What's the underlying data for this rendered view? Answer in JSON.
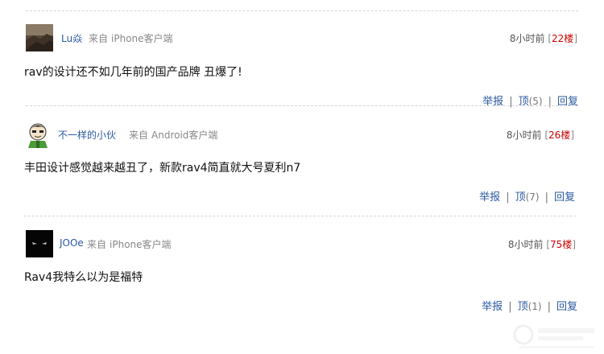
{
  "comments": [
    {
      "username": "Lu焱",
      "source_prefix": "来自",
      "source": "iPhone客户端",
      "time": "8小时前",
      "floor": "22楼",
      "content": "rav的设计还不如几年前的国产品牌 丑爆了!",
      "report_label": "举报",
      "up_label": "顶",
      "up_count": "(5)",
      "reply_label": "回复"
    },
    {
      "username": "不一样的小伙",
      "source_prefix": "来自",
      "source": "Android客户端",
      "time": "8小时前",
      "floor": "26楼",
      "content": "丰田设计感觉越来越丑了，新款rav4简直就大号夏利n7",
      "report_label": "举报",
      "up_label": "顶",
      "up_count": "(7)",
      "reply_label": "回复"
    },
    {
      "username": "JOOe",
      "source_prefix": "来自",
      "source": "iPhone客户端",
      "time": "8小时前",
      "floor": "75楼",
      "content": "Rav4我特么以为是福特",
      "report_label": "举报",
      "up_label": "顶",
      "up_count": "(1)",
      "reply_label": "回复"
    }
  ],
  "colors": {
    "link": "#2b59a0",
    "floor": "#cc0000",
    "divider": "#d6d6d6"
  }
}
